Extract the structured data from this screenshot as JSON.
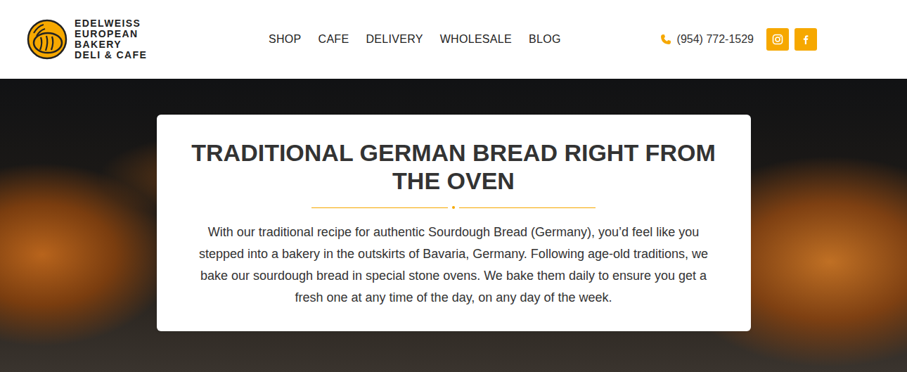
{
  "brand": {
    "lines": [
      "EDELWEISS",
      "EUROPEAN",
      "BAKERY",
      "DELI & CAFE"
    ]
  },
  "nav": [
    {
      "label": "SHOP"
    },
    {
      "label": "CAFE"
    },
    {
      "label": "DELIVERY"
    },
    {
      "label": "WHOLESALE"
    },
    {
      "label": "BLOG"
    }
  ],
  "phone": "(954) 772-1529",
  "hero": {
    "title": "TRADITIONAL GERMAN BREAD RIGHT FROM THE OVEN",
    "body": "With our traditional recipe for authentic Sourdough Bread (Germany), you’d feel like you stepped into a bakery in the outskirts of Bavaria, Germany. Following age-old traditions, we bake our sourdough bread in special stone ovens. We bake them daily to ensure you get a fresh one at any time of the day, on any day of the week."
  }
}
